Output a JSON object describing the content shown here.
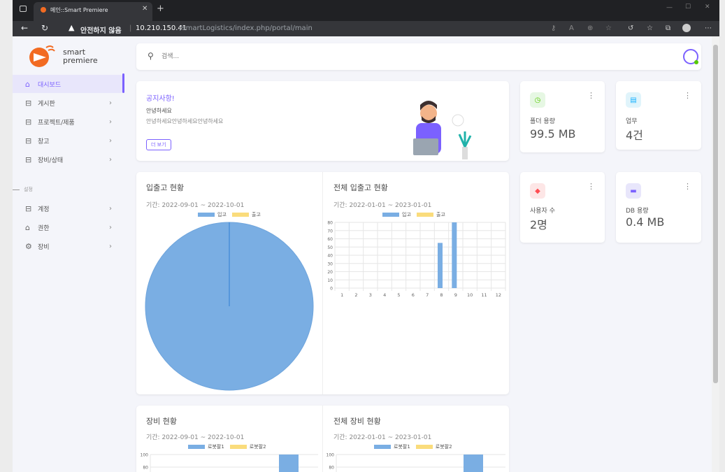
{
  "browser": {
    "tab_title": "메인::Smart Premiere",
    "new_tab_symbol": "+",
    "security_label": "안전하지 않음",
    "url_host": "10.210.150.41",
    "url_path": "/smartLogistics/index.php/portal/main"
  },
  "brand": {
    "line1": "smart",
    "line2": "premiere"
  },
  "search": {
    "placeholder": "검색..."
  },
  "sidebar": {
    "items": [
      {
        "label": "대시보드",
        "icon": "home-icon",
        "active": true
      },
      {
        "label": "게시판",
        "icon": "board-icon"
      },
      {
        "label": "프로젝트/제품",
        "icon": "project-icon"
      },
      {
        "label": "창고",
        "icon": "warehouse-icon"
      },
      {
        "label": "장비/상태",
        "icon": "equipment-icon"
      }
    ],
    "section_label": "설정",
    "settings_items": [
      {
        "label": "계정",
        "icon": "account-icon"
      },
      {
        "label": "권한",
        "icon": "lock-icon"
      },
      {
        "label": "장비",
        "icon": "gear-icon"
      }
    ]
  },
  "notice": {
    "title": "공지사항!",
    "heading": "안녕하세요",
    "body": "안녕하세요안녕하세요안녕하세요",
    "more_button": "더 보기"
  },
  "stats": [
    {
      "label": "폴더 용량",
      "value": "99.5 MB",
      "color": "#e6f7e3",
      "icon_color": "#56ca00"
    },
    {
      "label": "업무",
      "value": "4건",
      "color": "#e0f4fb",
      "icon_color": "#16b1ff"
    },
    {
      "label": "사용자 수",
      "value": "2명",
      "color": "#fde6e6",
      "icon_color": "#ff4c51"
    },
    {
      "label": "DB 용량",
      "value": "0.4 MB",
      "color": "#e8e6fb",
      "icon_color": "#7b61ff"
    }
  ],
  "charts": {
    "inout_title": "입출고 현황",
    "inout_period": "기간: 2022-09-01 ~ 2022-10-01",
    "inout_total_title": "전체 입출고 현황",
    "inout_total_period": "기간: 2022-01-01 ~ 2023-01-01",
    "equip_title": "장비 현황",
    "equip_period": "기간: 2022-09-01 ~ 2022-10-01",
    "equip_total_title": "전체 장비 현황",
    "equip_total_period": "기간: 2022-01-01 ~ 2023-01-01",
    "legend_in": "입고",
    "legend_out": "출고",
    "legend_r1": "로봇팔1",
    "legend_r2": "로봇팔2"
  },
  "chart_data": [
    {
      "type": "pie",
      "title": "입출고 현황",
      "labels": [
        "입고",
        "출고"
      ],
      "values": [
        100,
        0
      ],
      "colors": [
        "#7aaee3",
        "#fadc7c"
      ]
    },
    {
      "type": "bar",
      "title": "전체 입출고 현황",
      "categories": [
        "1",
        "2",
        "3",
        "4",
        "5",
        "6",
        "7",
        "8",
        "9",
        "10",
        "11",
        "12"
      ],
      "series": [
        {
          "name": "입고",
          "values": [
            0,
            0,
            0,
            0,
            0,
            0,
            0,
            55,
            80,
            0,
            0,
            0
          ],
          "color": "#7aaee3"
        },
        {
          "name": "출고",
          "values": [
            0,
            0,
            0,
            0,
            0,
            0,
            0,
            0,
            0,
            0,
            0,
            0
          ],
          "color": "#fadc7c"
        }
      ],
      "ylim": [
        0,
        80
      ],
      "yticks": [
        0,
        10,
        20,
        30,
        40,
        50,
        60,
        70,
        80
      ]
    },
    {
      "type": "bar",
      "title": "장비 현황",
      "ylim": [
        0,
        100
      ],
      "yticks": [
        80,
        100
      ],
      "series": [
        {
          "name": "로봇팔1",
          "color": "#7aaee3"
        },
        {
          "name": "로봇팔2",
          "color": "#fadc7c"
        }
      ]
    },
    {
      "type": "bar",
      "title": "전체 장비 현황",
      "ylim": [
        0,
        100
      ],
      "yticks": [
        80,
        100
      ],
      "series": [
        {
          "name": "로봇팔1",
          "color": "#7aaee3"
        },
        {
          "name": "로봇팔2",
          "color": "#fadc7c"
        }
      ]
    }
  ]
}
